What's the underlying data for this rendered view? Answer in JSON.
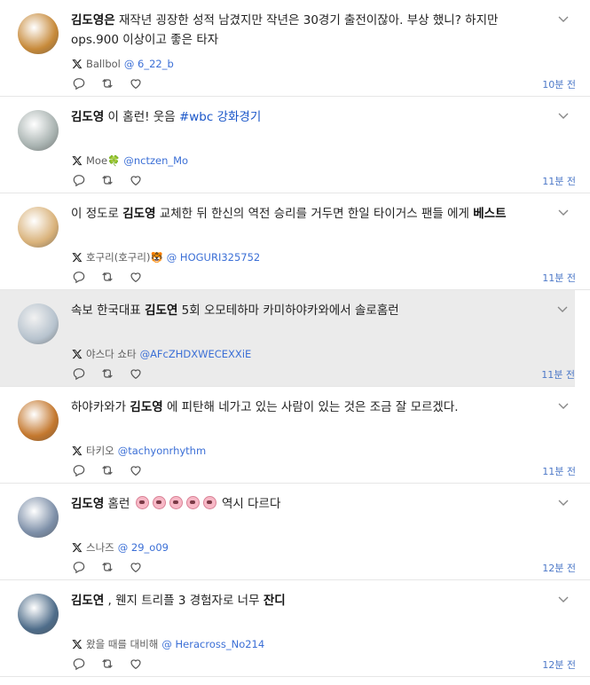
{
  "tweets": [
    {
      "segments": [
        {
          "t": "김도영은",
          "b": true
        },
        {
          "t": " 재작년 굉장한 성적 남겼지만 작년은 30경기 출전이잖아. 부상 했니? 하지만 ops.900 이상이고 좋은 타자"
        }
      ],
      "display_name": "Ballbol",
      "handle": "@ 6_22_b",
      "time": "10분 전",
      "avatar_color": "#c78a3a"
    },
    {
      "segments": [
        {
          "t": "김도영",
          "b": true
        },
        {
          "t": " 이 홈런! 웃음 "
        },
        {
          "t": "#wbc 강화경기",
          "tag": true
        }
      ],
      "display_name": "Moe🍀",
      "handle": "@nctzen_Mo",
      "time": "11분 전",
      "avatar_color": "#a9b3b1"
    },
    {
      "segments": [
        {
          "t": "이 정도로 "
        },
        {
          "t": "김도영",
          "b": true
        },
        {
          "t": " 교체한 뒤 한신의 역전 승리를 거두면 한일 타이거스 팬들 에게 "
        },
        {
          "t": "베스트",
          "b": true
        }
      ],
      "display_name": "호구리(호구리)🐯",
      "handle": "@ HOGURI325752",
      "time": "11분 전",
      "avatar_color": "#d9b27a"
    },
    {
      "segments": [
        {
          "t": "속보 한국대표 "
        },
        {
          "t": "김도연",
          "b": true
        },
        {
          "t": " 5회 오모테하마 카미하야카와에서 솔로홈런"
        }
      ],
      "display_name": "야스다 쇼타",
      "handle": "@AFcZHDXWECEXXiE",
      "time": "11분 전",
      "avatar_color": "#b7c3ce",
      "highlight": true
    },
    {
      "segments": [
        {
          "t": "하야카와가 "
        },
        {
          "t": "김도영",
          "b": true
        },
        {
          "t": " 에 피탄해 네가고 있는 사람이 있는 것은 조금 잘 모르겠다."
        }
      ],
      "display_name": "타키오",
      "handle": "@tachyonrhythm",
      "time": "11분 전",
      "avatar_color": "#c4782e"
    },
    {
      "segments": [
        {
          "t": "김도영",
          "b": true
        },
        {
          "t": " 홈런 "
        },
        {
          "emoji": 5
        },
        {
          "t": " 역시 다르다"
        }
      ],
      "display_name": "스나즈",
      "handle": "@ 29_o09",
      "time": "12분 전",
      "avatar_color": "#7d8fa8"
    },
    {
      "segments": [
        {
          "t": "김도연",
          "b": true
        },
        {
          "t": " , 웬지 트리플 3 경험자로 너무 "
        },
        {
          "t": "잔디",
          "b": true
        }
      ],
      "display_name": "왔을 때를 대비해",
      "handle": "@ Heracross_No214",
      "time": "12분 전",
      "avatar_color": "#4f6d8a"
    }
  ]
}
